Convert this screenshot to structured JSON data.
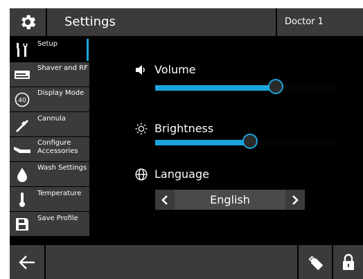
{
  "header": {
    "title": "Settings",
    "user": "Doctor 1",
    "gear_icon": "gear-icon"
  },
  "sidebar": {
    "items": [
      {
        "label": "Setup",
        "icon": "tools-icon",
        "active": true
      },
      {
        "label": "Shaver and RF",
        "icon": "shaver-device-icon"
      },
      {
        "label": "Display Mode",
        "icon": "display-mode-40-icon"
      },
      {
        "label": "Cannula",
        "icon": "cannula-icon"
      },
      {
        "label": "Configure Accessories",
        "icon": "accessories-icon"
      },
      {
        "label": "Wash Settings",
        "icon": "droplet-icon"
      },
      {
        "label": "Temperature",
        "icon": "thermometer-icon"
      },
      {
        "label": "Save Profile",
        "icon": "save-disk-icon"
      }
    ]
  },
  "settings": {
    "volume": {
      "label": "Volume",
      "level": 0.66
    },
    "brightness": {
      "label": "Brightness",
      "level": 0.52
    },
    "language": {
      "label": "Language",
      "value": "English"
    }
  },
  "footer": {
    "back_icon": "back-arrow-icon",
    "usb_icon": "usb-drive-icon",
    "lock_icon": "lock-icon"
  },
  "colors": {
    "accent": "#1ba4dc",
    "panel": "#3b3b3b",
    "background": "#000000"
  }
}
